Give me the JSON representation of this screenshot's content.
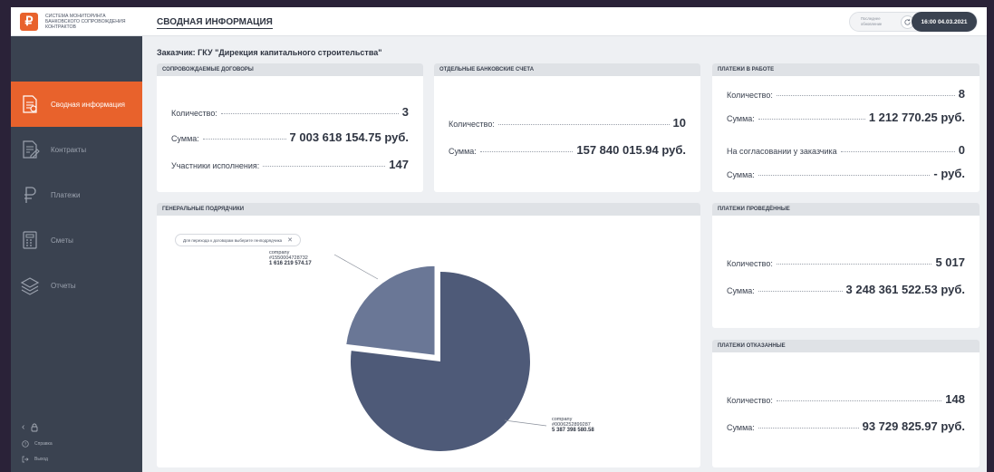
{
  "sidebar": {
    "brand_text": "СИСТЕМА МОНИТОРИНГА БАНКОВСКОГО СОПРОВОЖДЕНИЯ КОНТРАКТОВ",
    "items": [
      {
        "label": "Сводная информация",
        "icon": "report-icon",
        "active": true
      },
      {
        "label": "Контракты",
        "icon": "contract-edit-icon",
        "active": false
      },
      {
        "label": "Платежи",
        "icon": "ruble-icon",
        "active": false
      },
      {
        "label": "Сметы",
        "icon": "calculator-icon",
        "active": false
      },
      {
        "label": "Отчеты",
        "icon": "layers-icon",
        "active": false
      }
    ],
    "help_label": "Справка",
    "logout_label": "Выход"
  },
  "header": {
    "title": "СВОДНАЯ ИНФОРМАЦИЯ",
    "update_label": "Последнее обновление",
    "update_time": "16:00 04.03.2021"
  },
  "customer": "Заказчик: ГКУ \"Дирекция капитального строительства\"",
  "cards": {
    "contracts": {
      "title": "СОПРОВОЖДАЕМЫЕ ДОГОВОРЫ",
      "rows": [
        {
          "label": "Количество:",
          "value": "3"
        },
        {
          "label": "Сумма:",
          "value": "7 003 618 154.75 руб."
        },
        {
          "label": "Участники исполнения:",
          "value": "147"
        }
      ]
    },
    "accounts": {
      "title": "ОТДЕЛЬНЫЕ БАНКОВСКИЕ СЧЕТА",
      "rows": [
        {
          "label": "Количество:",
          "value": "10"
        },
        {
          "label": "Сумма:",
          "value": "157 840 015.94 руб."
        }
      ]
    },
    "payments_work": {
      "title": "ПЛАТЕЖИ В РАБОТЕ",
      "rows": [
        {
          "label": "Количество:",
          "value": "8"
        },
        {
          "label": "Сумма:",
          "value": "1 212 770.25 руб."
        },
        {
          "label": "На согласовании у заказчика",
          "value": "0"
        },
        {
          "label": "Сумма:",
          "value": "- руб."
        }
      ]
    },
    "payments_done": {
      "title": "ПЛАТЕЖИ ПРОВЕДЁННЫЕ",
      "rows": [
        {
          "label": "Количество:",
          "value": "5 017"
        },
        {
          "label": "Сумма:",
          "value": "3 248 361 522.53 руб."
        }
      ]
    },
    "payments_rejected": {
      "title": "ПЛАТЕЖИ ОТКАЗАННЫЕ",
      "rows": [
        {
          "label": "Количество:",
          "value": "148"
        },
        {
          "label": "Сумма:",
          "value": "93 729 825.97 руб."
        }
      ]
    },
    "contractors": {
      "title": "ГЕНЕРАЛЬНЫЕ ПОДРЯДЧИКИ",
      "hint": "Для перехода к договорам выберите генподрядчика"
    }
  },
  "chart_data": {
    "type": "pie",
    "slices": [
      {
        "name": "company",
        "id": "#1550004728732",
        "value": 1616219574.17,
        "value_label": "1 616 219 574.17",
        "color": "#6a7796"
      },
      {
        "name": "company",
        "id": "#0006252899287",
        "value": 5387398580.58,
        "value_label": "5 387 398 580.58",
        "color": "#4e5a78"
      }
    ]
  }
}
